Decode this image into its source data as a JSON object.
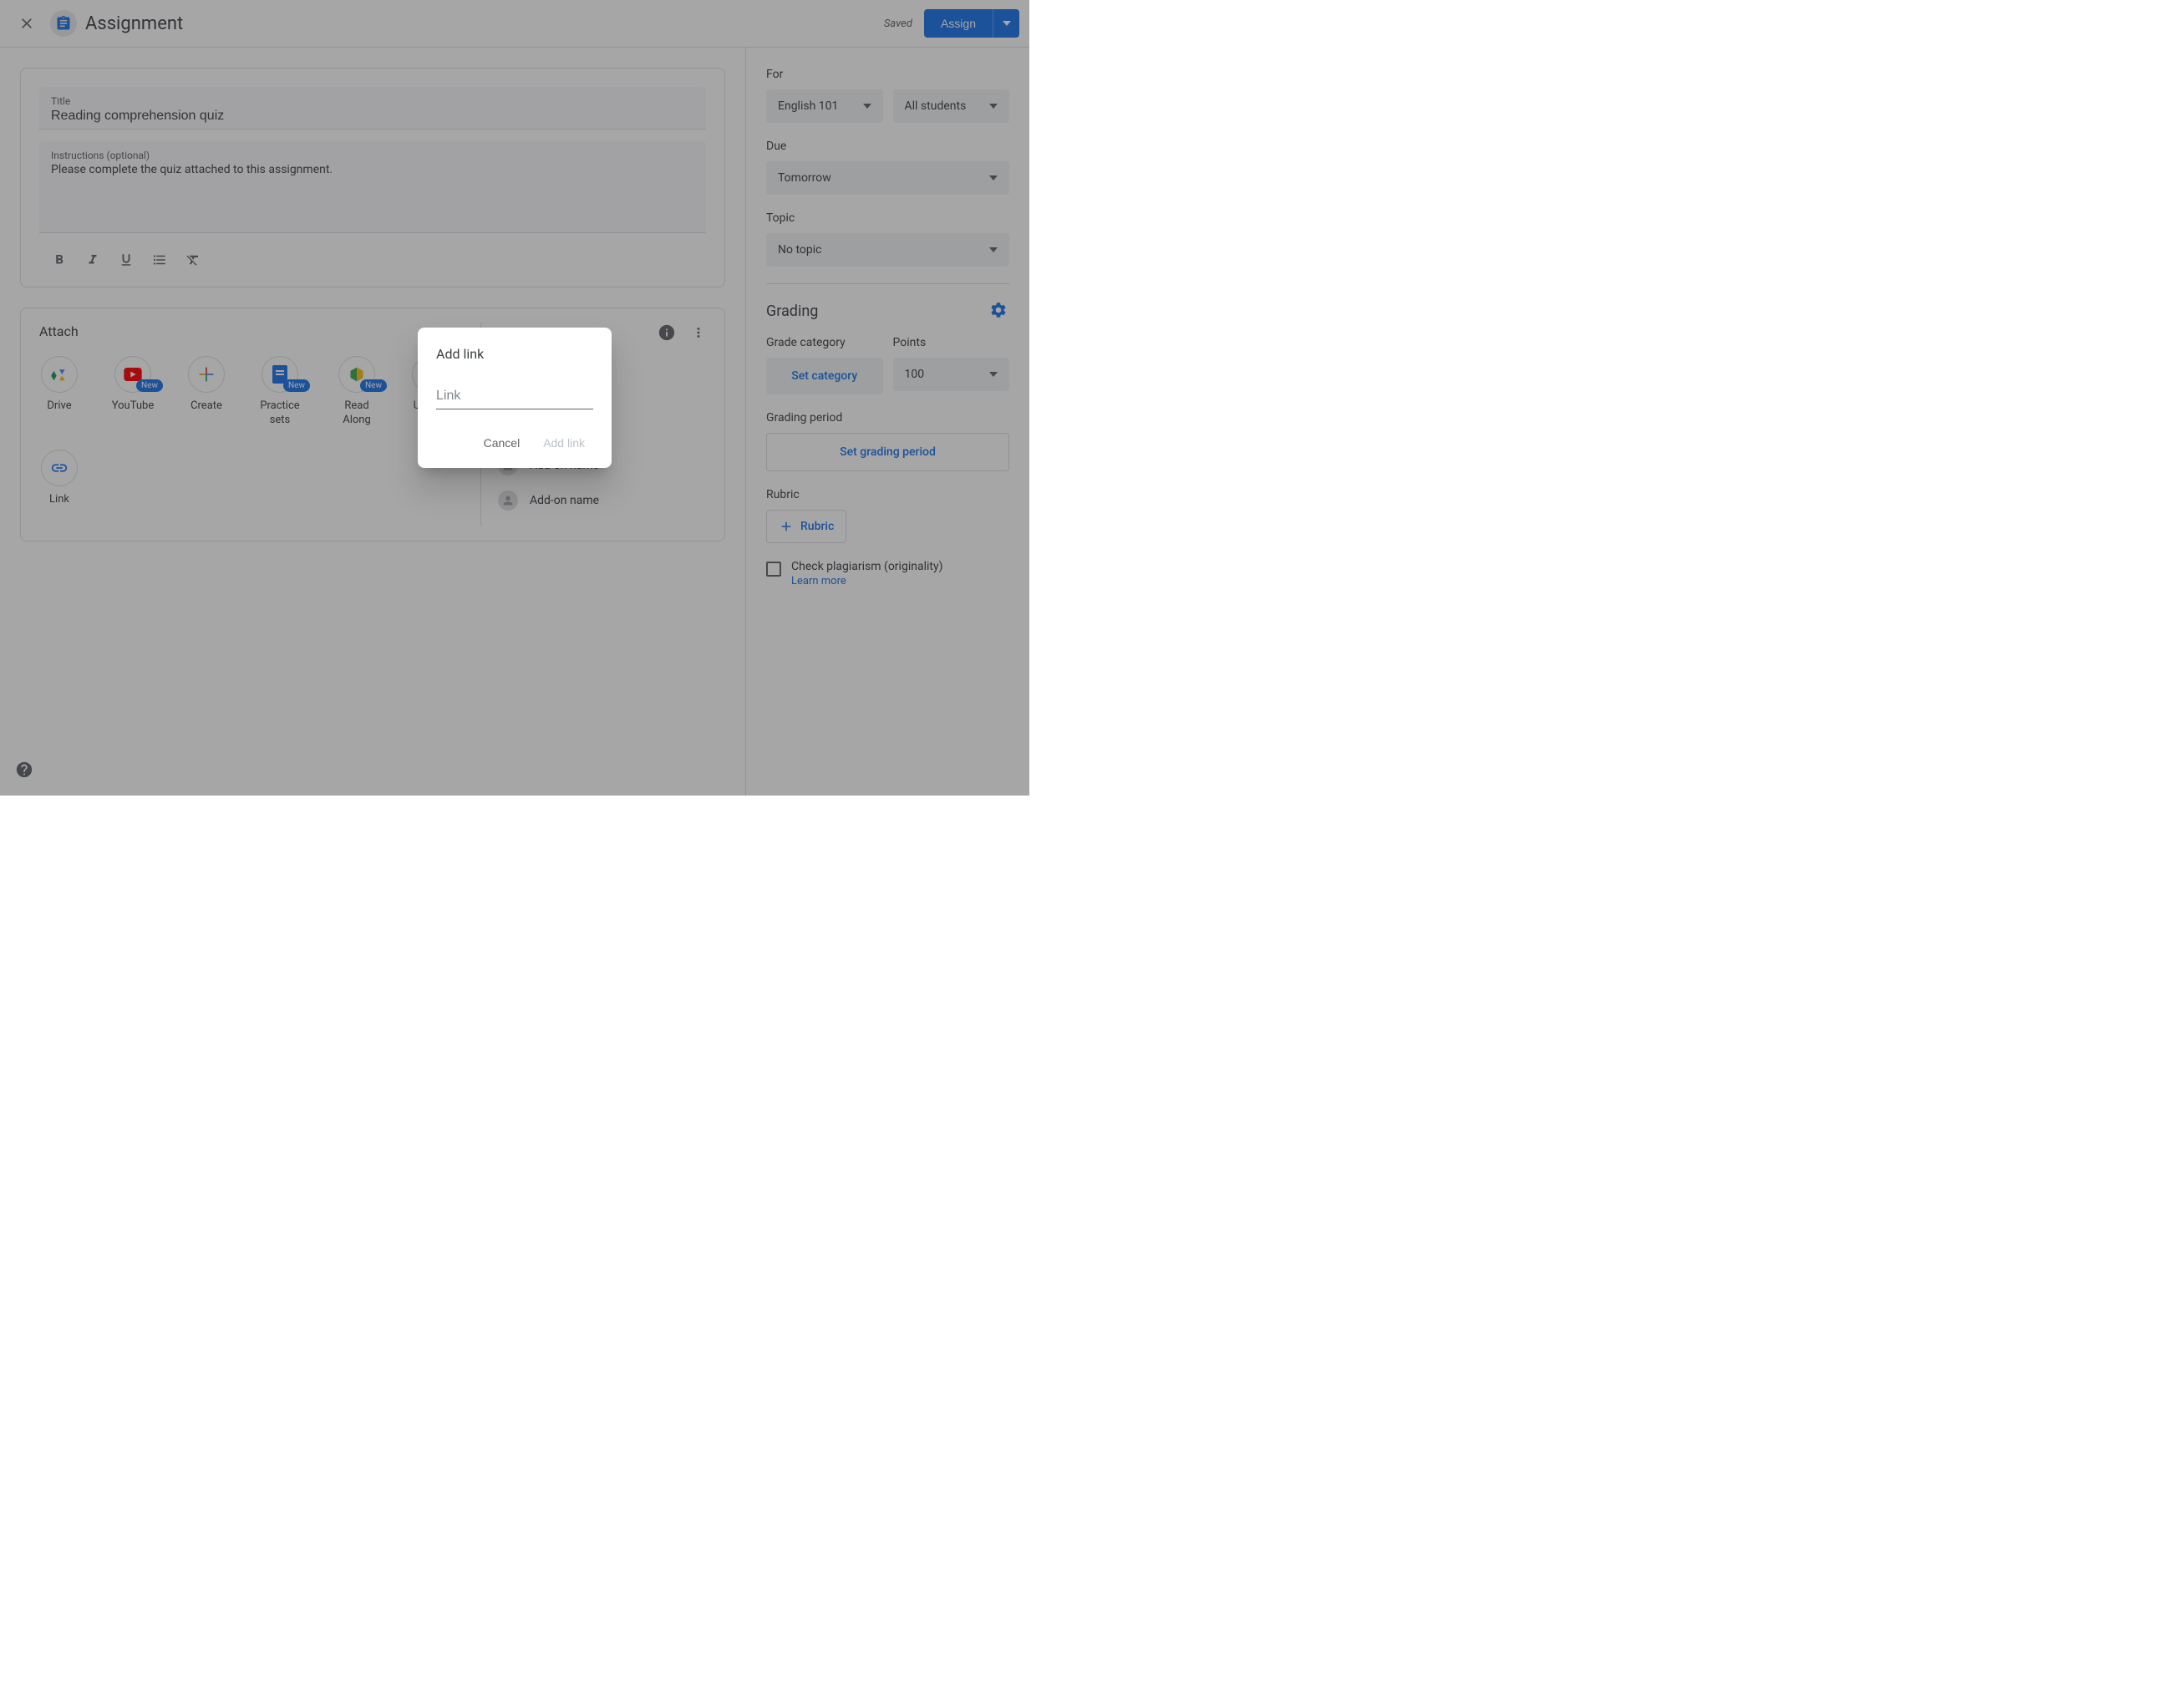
{
  "header": {
    "page_title": "Assignment",
    "saved": "Saved",
    "assign": "Assign"
  },
  "form": {
    "title_label": "Title",
    "title_value": "Reading comprehension quiz",
    "instructions_label": "Instructions (optional)",
    "instructions_value": "Please complete the quiz attached to this assignment."
  },
  "attach": {
    "title": "Attach",
    "items": {
      "drive": "Drive",
      "youtube": "YouTube",
      "create": "Create",
      "practice": "Practice sets",
      "readalong": "Read Along",
      "upload": "Upload",
      "link": "Link"
    },
    "new_badge": "New",
    "addon": "Add-on name"
  },
  "sidebar": {
    "for_label": "For",
    "class_value": "English 101",
    "students_value": "All students",
    "due_label": "Due",
    "due_value": "Tomorrow",
    "topic_label": "Topic",
    "topic_value": "No topic",
    "grading_label": "Grading",
    "grade_category_label": "Grade category",
    "set_category": "Set category",
    "points_label": "Points",
    "points_value": "100",
    "grading_period_label": "Grading period",
    "set_grading_period": "Set grading period",
    "rubric_label": "Rubric",
    "rubric_btn": "Rubric",
    "plagiarism": "Check plagiarism (originality)",
    "learn_more": "Learn more"
  },
  "dialog": {
    "title": "Add link",
    "placeholder": "Link",
    "cancel": "Cancel",
    "add": "Add link"
  }
}
